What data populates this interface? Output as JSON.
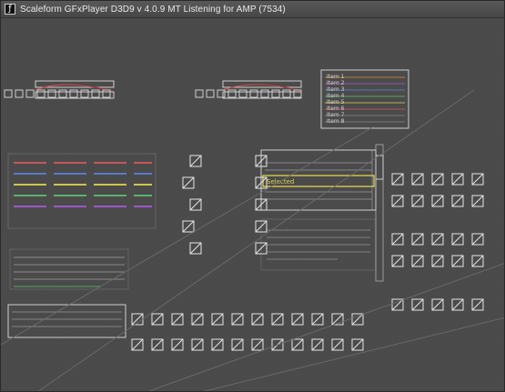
{
  "window": {
    "title": "Scaleform GFxPlayer D3D9 v 4.0.9  MT  Listening for AMP (7534)",
    "icon": "sf-glyph",
    "icon_text": "ƒ"
  },
  "colors": {
    "bg": "#4a4a4a",
    "panel": "#5a5a5a",
    "outline": "#cfcfcf",
    "accent_red": "#d35a5a",
    "accent_blue": "#5d7fd8",
    "accent_yellow": "#e0d24d",
    "accent_orange": "#d4853b",
    "accent_green": "#5fbf6a",
    "accent_purple": "#a45ad6"
  },
  "canvas": {
    "highlight_text": "Selected",
    "top_right_list": [
      "Item 1",
      "Item 2",
      "Item 3",
      "Item 4",
      "Item 5",
      "Item 6",
      "Item 7",
      "Item 8"
    ]
  }
}
